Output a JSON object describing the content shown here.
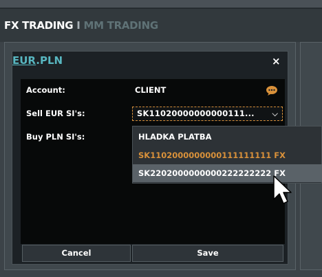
{
  "tabs": {
    "fx_label": "FX TRADING",
    "separator": "I",
    "mm_label": "MM TRADING"
  },
  "dialog": {
    "currency_from": "EUR",
    "currency_sep": ".",
    "currency_to": "PLN",
    "close_symbol": "×",
    "account_label": "Account:",
    "account_value": "CLIENT",
    "sell_label": "Sell EUR SI's:",
    "sell_selected": "SK11020000000000111...",
    "buy_label": "Buy PLN SI's:",
    "options": [
      "HLADKA PLATBA",
      "SK1102000000000111111111 FX",
      "SK2202000000000222222222 FX"
    ],
    "cancel_label": "Cancel",
    "save_label": "Save"
  },
  "icons": {
    "chat": "chat-bubble-icon",
    "chevron": "chevron-down-icon",
    "close": "close-icon",
    "cursor": "mouse-pointer"
  },
  "colors": {
    "accent_teal": "#58b6c0",
    "highlight_orange": "#d9913a",
    "selected_row": "#5a6268"
  }
}
